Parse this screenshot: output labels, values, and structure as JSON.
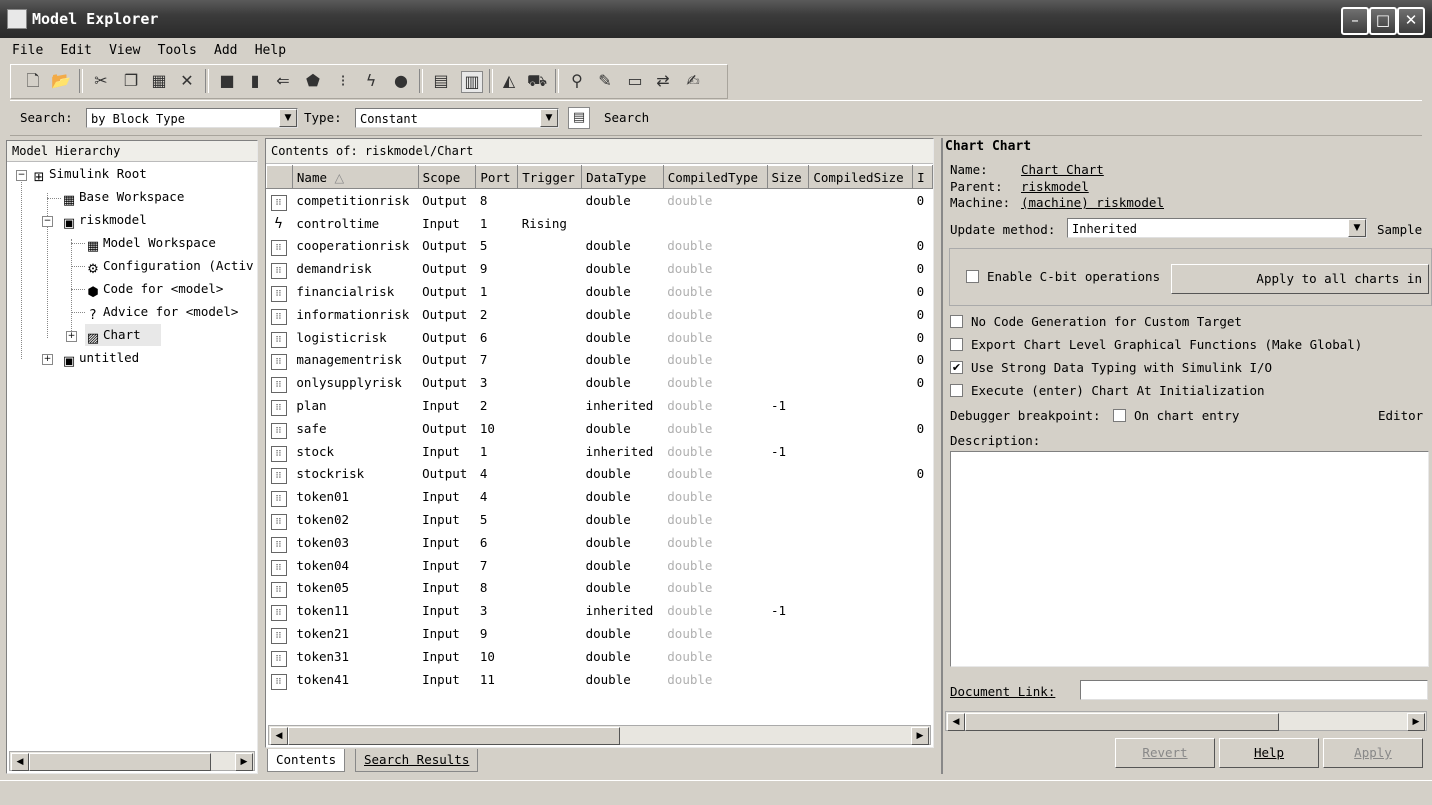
{
  "window": {
    "title": "Model Explorer"
  },
  "menu": [
    "File",
    "Edit",
    "View",
    "Tools",
    "Add",
    "Help"
  ],
  "toolbar_icons": [
    "new-icon",
    "open-icon",
    "cut-icon",
    "copy-icon",
    "paste-icon",
    "delete-icon",
    "block-icon",
    "chart-icon",
    "port-icon",
    "subsystem-icon",
    "bus-icon",
    "event-icon",
    "record-icon",
    "grid-icon",
    "list-icon",
    "simulink-icon",
    "stateflow-icon",
    "search-icon",
    "edit-icon",
    "frame-icon",
    "swap-icon",
    "notes-icon"
  ],
  "search": {
    "label": "Search:",
    "by_value": "by Block Type",
    "type_label": "Type:",
    "type_value": "Constant",
    "button": "Search"
  },
  "hierarchy": {
    "header": "Model Hierarchy",
    "nodes": [
      {
        "label": "Simulink Root",
        "icon": "simulink-root-icon"
      },
      {
        "label": "Base Workspace",
        "icon": "workspace-icon"
      },
      {
        "label": "riskmodel",
        "icon": "model-icon"
      },
      {
        "label": "Model Workspace",
        "icon": "workspace-icon"
      },
      {
        "label": "Configuration (Activ",
        "icon": "config-icon"
      },
      {
        "label": "Code for <model>",
        "icon": "code-icon"
      },
      {
        "label": "Advice for <model>",
        "icon": "advice-icon"
      },
      {
        "label": "Chart",
        "icon": "chart-icon"
      },
      {
        "label": "untitled",
        "icon": "model-icon"
      }
    ]
  },
  "contents": {
    "header": "Contents of:  riskmodel/Chart",
    "columns": [
      "Name",
      "Scope",
      "Port",
      "Trigger",
      "DataType",
      "CompiledType",
      "Size",
      "CompiledSize",
      "I"
    ],
    "rows": [
      [
        "competitionrisk",
        "Output",
        "8",
        "",
        "double",
        "double",
        "",
        "",
        "0"
      ],
      [
        "controltime",
        "Input",
        "1",
        "Rising",
        "",
        "",
        "",
        "",
        ""
      ],
      [
        "cooperationrisk",
        "Output",
        "5",
        "",
        "double",
        "double",
        "",
        "",
        "0"
      ],
      [
        "demandrisk",
        "Output",
        "9",
        "",
        "double",
        "double",
        "",
        "",
        "0"
      ],
      [
        "financialrisk",
        "Output",
        "1",
        "",
        "double",
        "double",
        "",
        "",
        "0"
      ],
      [
        "informationrisk",
        "Output",
        "2",
        "",
        "double",
        "double",
        "",
        "",
        "0"
      ],
      [
        "logisticrisk",
        "Output",
        "6",
        "",
        "double",
        "double",
        "",
        "",
        "0"
      ],
      [
        "managementrisk",
        "Output",
        "7",
        "",
        "double",
        "double",
        "",
        "",
        "0"
      ],
      [
        "onlysupplyrisk",
        "Output",
        "3",
        "",
        "double",
        "double",
        "",
        "",
        "0"
      ],
      [
        "plan",
        "Input",
        "2",
        "",
        "inherited",
        "double",
        "-1",
        "",
        ""
      ],
      [
        "safe",
        "Output",
        "10",
        "",
        "double",
        "double",
        "",
        "",
        "0"
      ],
      [
        "stock",
        "Input",
        "1",
        "",
        "inherited",
        "double",
        "-1",
        "",
        ""
      ],
      [
        "stockrisk",
        "Output",
        "4",
        "",
        "double",
        "double",
        "",
        "",
        "0"
      ],
      [
        "token01",
        "Input",
        "4",
        "",
        "double",
        "double",
        "",
        "",
        ""
      ],
      [
        "token02",
        "Input",
        "5",
        "",
        "double",
        "double",
        "",
        "",
        ""
      ],
      [
        "token03",
        "Input",
        "6",
        "",
        "double",
        "double",
        "",
        "",
        ""
      ],
      [
        "token04",
        "Input",
        "7",
        "",
        "double",
        "double",
        "",
        "",
        ""
      ],
      [
        "token05",
        "Input",
        "8",
        "",
        "double",
        "double",
        "",
        "",
        ""
      ],
      [
        "token11",
        "Input",
        "3",
        "",
        "inherited",
        "double",
        "-1",
        "",
        ""
      ],
      [
        "token21",
        "Input",
        "9",
        "",
        "double",
        "double",
        "",
        "",
        ""
      ],
      [
        "token31",
        "Input",
        "10",
        "",
        "double",
        "double",
        "",
        "",
        ""
      ],
      [
        "token41",
        "Input",
        "11",
        "",
        "double",
        "double",
        "",
        "",
        ""
      ]
    ],
    "tabs": [
      "Contents",
      "Search Results"
    ]
  },
  "details": {
    "title": "Chart Chart",
    "name_label": "Name:",
    "name_value": "Chart Chart",
    "parent_label": "Parent:",
    "parent_value": "riskmodel",
    "machine_label": "Machine:",
    "machine_value": "(machine) riskmodel",
    "update_label": "Update method:",
    "update_value": "Inherited",
    "sample_label": "Sample",
    "cbit_label": "Enable C-bit operations",
    "apply_all_label": "Apply to all charts in",
    "options": [
      {
        "label": "No Code Generation for Custom Target",
        "checked": false
      },
      {
        "label": "Export Chart Level Graphical Functions (Make Global)",
        "checked": false
      },
      {
        "label": "Use Strong Data Typing with Simulink I/O",
        "checked": true
      },
      {
        "label": "Execute (enter) Chart At Initialization",
        "checked": false
      }
    ],
    "debugger_label": "Debugger breakpoint:",
    "on_entry_label": "On chart entry",
    "editor_label": "Editor",
    "description_label": "Description:",
    "doc_link_label": "Document Link:",
    "buttons": {
      "revert": "Revert",
      "help": "Help",
      "apply": "Apply"
    }
  }
}
